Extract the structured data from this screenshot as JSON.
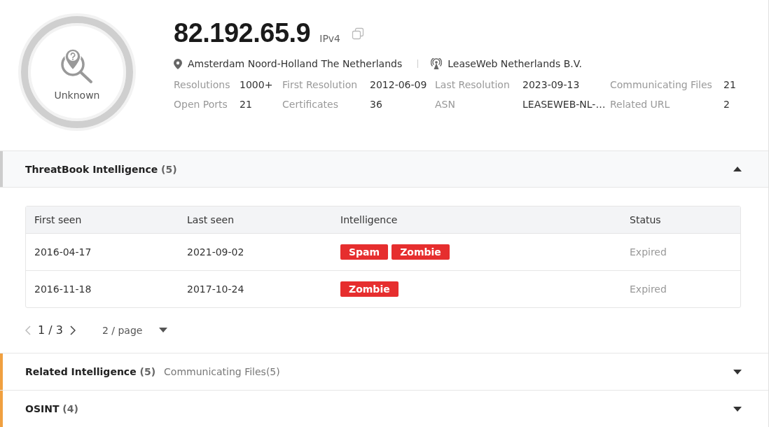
{
  "verdict": {
    "label": "Unknown"
  },
  "ip": {
    "address": "82.192.65.9",
    "version": "IPv4",
    "location": "Amsterdam Noord-Holland The Netherlands",
    "isp": "LeaseWeb Netherlands B.V."
  },
  "stats": [
    {
      "label": "Resolutions",
      "value": "1000+"
    },
    {
      "label": "First Resolution",
      "value": "2012-06-09"
    },
    {
      "label": "Last Resolution",
      "value": "2023-09-13"
    },
    {
      "label": "Communicating Files",
      "value": "21"
    },
    {
      "label": "Open Ports",
      "value": "21"
    },
    {
      "label": "Certificates",
      "value": "36"
    },
    {
      "label": "ASN",
      "value": "LEASEWEB-NL-…"
    },
    {
      "label": "Related URL",
      "value": "2"
    }
  ],
  "sections": [
    {
      "title": "ThreatBook Intelligence",
      "count": "(5)",
      "expanded": true,
      "color": "#cccccc",
      "table": {
        "columns": [
          "First seen",
          "Last seen",
          "Intelligence",
          "Status"
        ],
        "rows": [
          {
            "first_seen": "2016-04-17",
            "last_seen": "2021-09-02",
            "tags": [
              "Spam",
              "Zombie"
            ],
            "status": "Expired"
          },
          {
            "first_seen": "2016-11-18",
            "last_seen": "2017-10-24",
            "tags": [
              "Zombie"
            ],
            "status": "Expired"
          }
        ]
      },
      "pagination": {
        "current": "1 / 3",
        "page_size": "2 / page"
      }
    },
    {
      "title": "Related Intelligence",
      "count": "(5)",
      "subtitle": "Communicating Files(5)",
      "expanded": false,
      "color": "#f0a040"
    },
    {
      "title": "OSINT",
      "count": "(4)",
      "expanded": false,
      "color": "#f0a040"
    }
  ]
}
